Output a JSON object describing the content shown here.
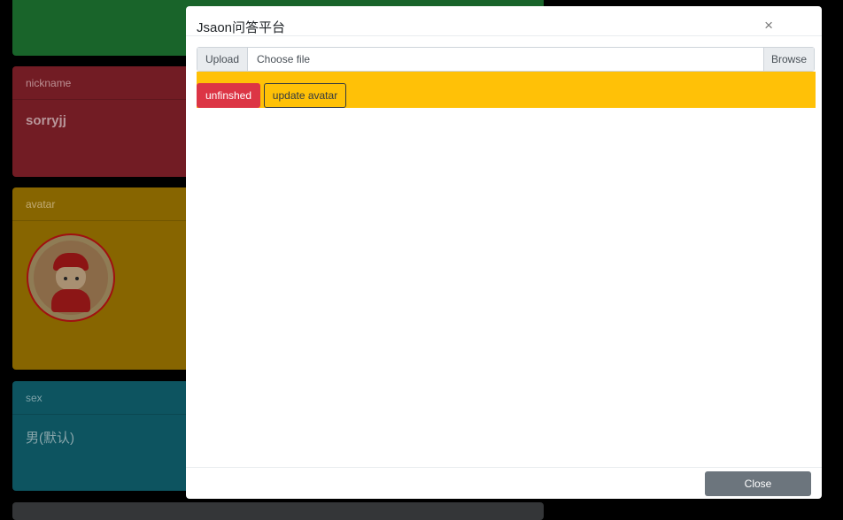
{
  "background_cards": {
    "nickname": {
      "header": "nickname",
      "value": "sorryjj"
    },
    "avatar": {
      "header": "avatar"
    },
    "sex": {
      "header": "sex",
      "value": "男(默认)"
    }
  },
  "modal": {
    "title": "Jsaon问答平台",
    "close_icon": "×",
    "upload": {
      "label": "Upload",
      "placeholder": "Choose file",
      "browse_label": "Browse"
    },
    "actions": {
      "unfinished_label": "unfinshed",
      "update_label": "update avatar"
    },
    "footer": {
      "close_label": "Close"
    }
  },
  "colors": {
    "action_bar": "#ffc107",
    "danger": "#dc3545",
    "secondary": "#6c757d"
  }
}
